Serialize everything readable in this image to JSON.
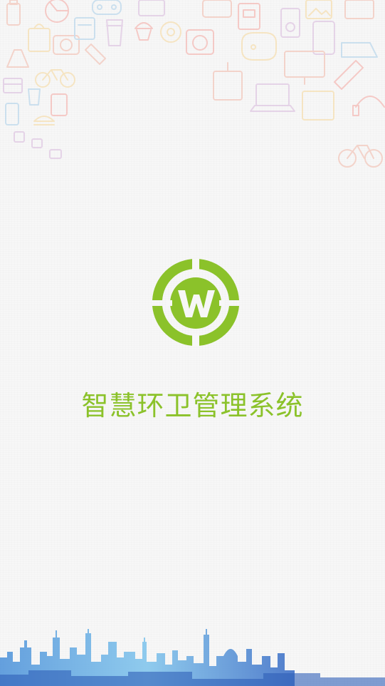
{
  "app": {
    "title": "智慧环卫管理系统"
  },
  "theme": {
    "brand_color": "#8bc22a",
    "background": "#f7f7f7",
    "doodle_colors": [
      "#f2b8a8",
      "#f6d79a",
      "#a9cfe9",
      "#d8b8dc",
      "#f4a6a0"
    ],
    "skyline_colors": [
      "#3f7fd1",
      "#6fb7e8",
      "#2f5fb8"
    ]
  },
  "icons": {
    "logo": "w-globe-logo",
    "decor_top": "shopping-doodles",
    "decor_bottom": "city-skyline"
  }
}
